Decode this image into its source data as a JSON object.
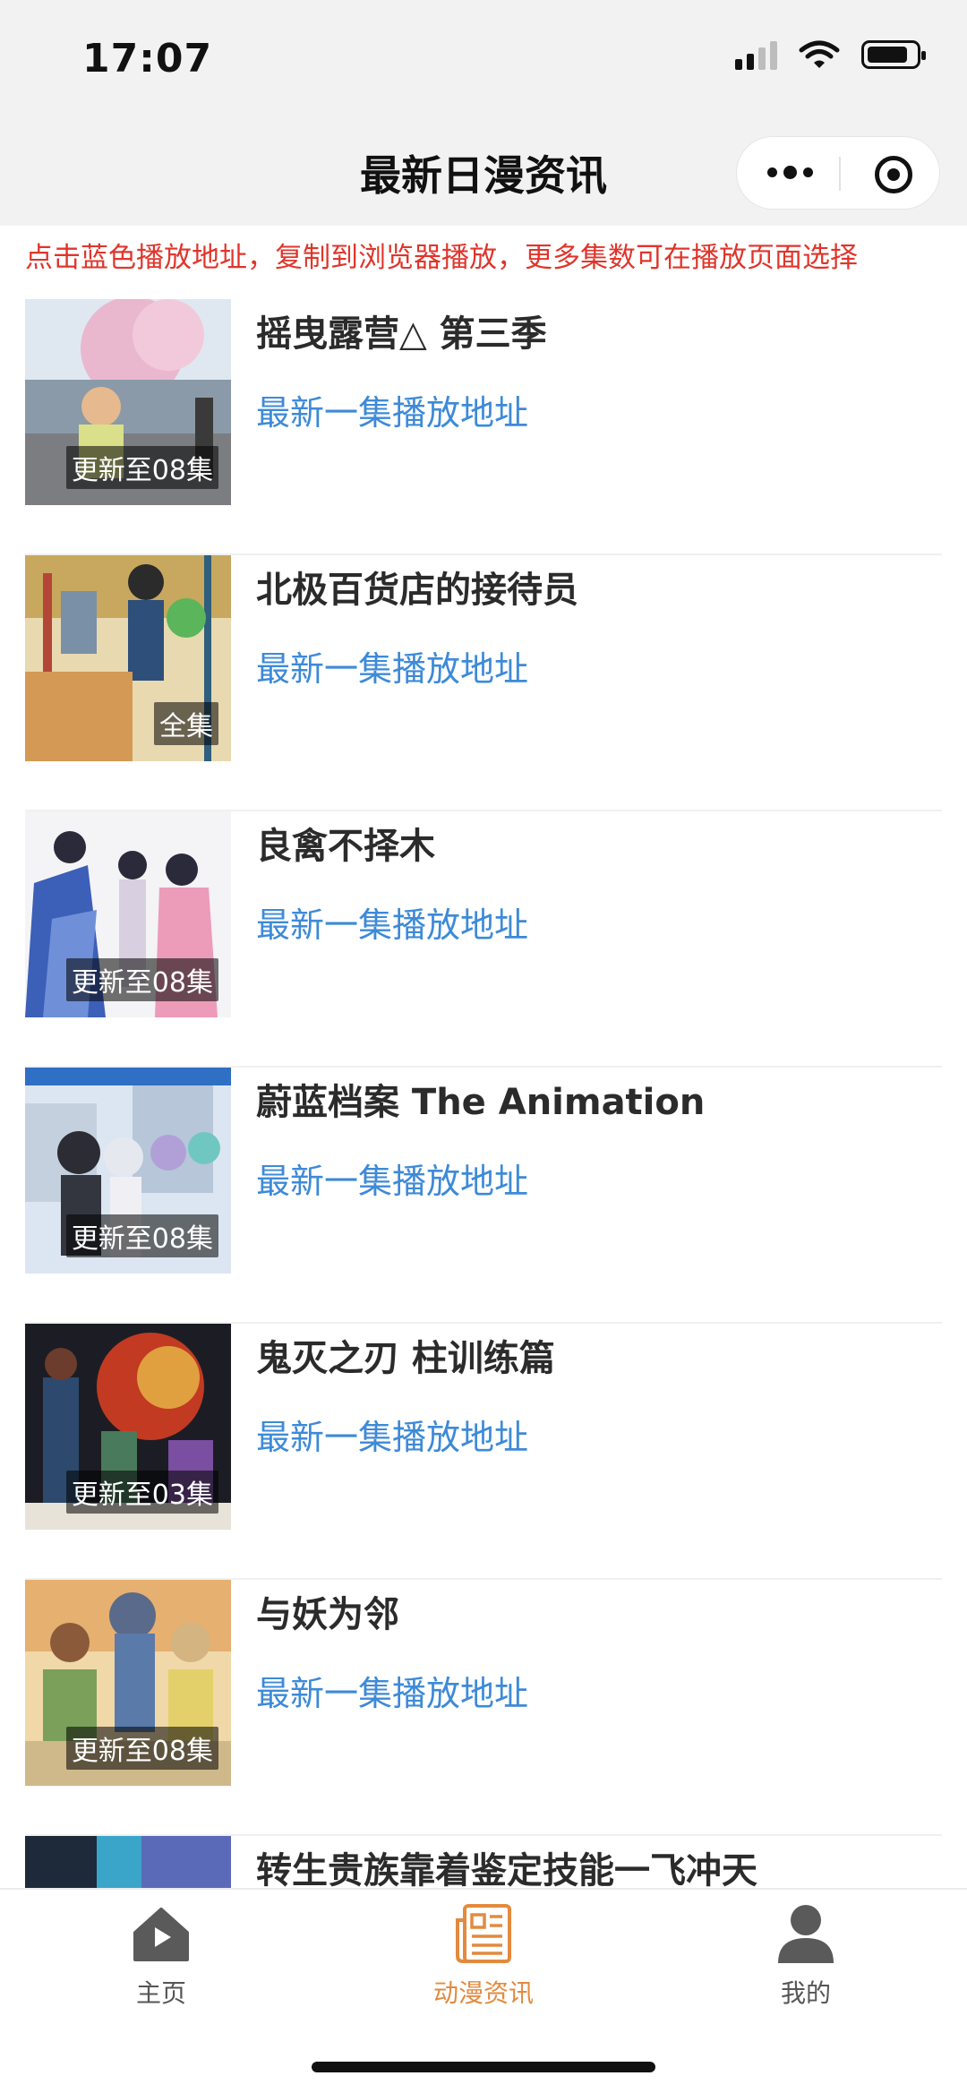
{
  "status": {
    "time": "17:07",
    "signal_icon": "signal-icon",
    "wifi_icon": "wifi-icon",
    "battery_icon": "battery-icon"
  },
  "header": {
    "title": "最新日漫资讯",
    "more_icon": "more-dots-icon",
    "close_icon": "target-close-icon"
  },
  "notice": "点击蓝色播放地址，复制到浏览器播放，更多集数可在播放页面选择",
  "colors": {
    "notice": "#e0352b",
    "link": "#3d8ad8",
    "active_tab": "#e38a3e",
    "badge_bg": "#000000"
  },
  "items": [
    {
      "title": "摇曳露营△ 第三季",
      "link": "最新一集播放地址",
      "badge": "更新至08集"
    },
    {
      "title": "北极百货店的接待员",
      "link": "最新一集播放地址",
      "badge": "全集"
    },
    {
      "title": "良禽不择木",
      "link": "最新一集播放地址",
      "badge": "更新至08集"
    },
    {
      "title": "蔚蓝档案 The Animation",
      "link": "最新一集播放地址",
      "badge": "更新至08集"
    },
    {
      "title": "鬼灭之刃 柱训练篇",
      "link": "最新一集播放地址",
      "badge": "更新至03集"
    },
    {
      "title": "与妖为邻",
      "link": "最新一集播放地址",
      "badge": "更新至08集"
    },
    {
      "title": "转生贵族靠着鉴定技能一飞冲天",
      "link": "",
      "badge": ""
    }
  ],
  "tabs": [
    {
      "label": "主页",
      "icon": "home-icon",
      "active": false
    },
    {
      "label": "动漫资讯",
      "icon": "news-icon",
      "active": true
    },
    {
      "label": "我的",
      "icon": "user-icon",
      "active": false
    }
  ]
}
